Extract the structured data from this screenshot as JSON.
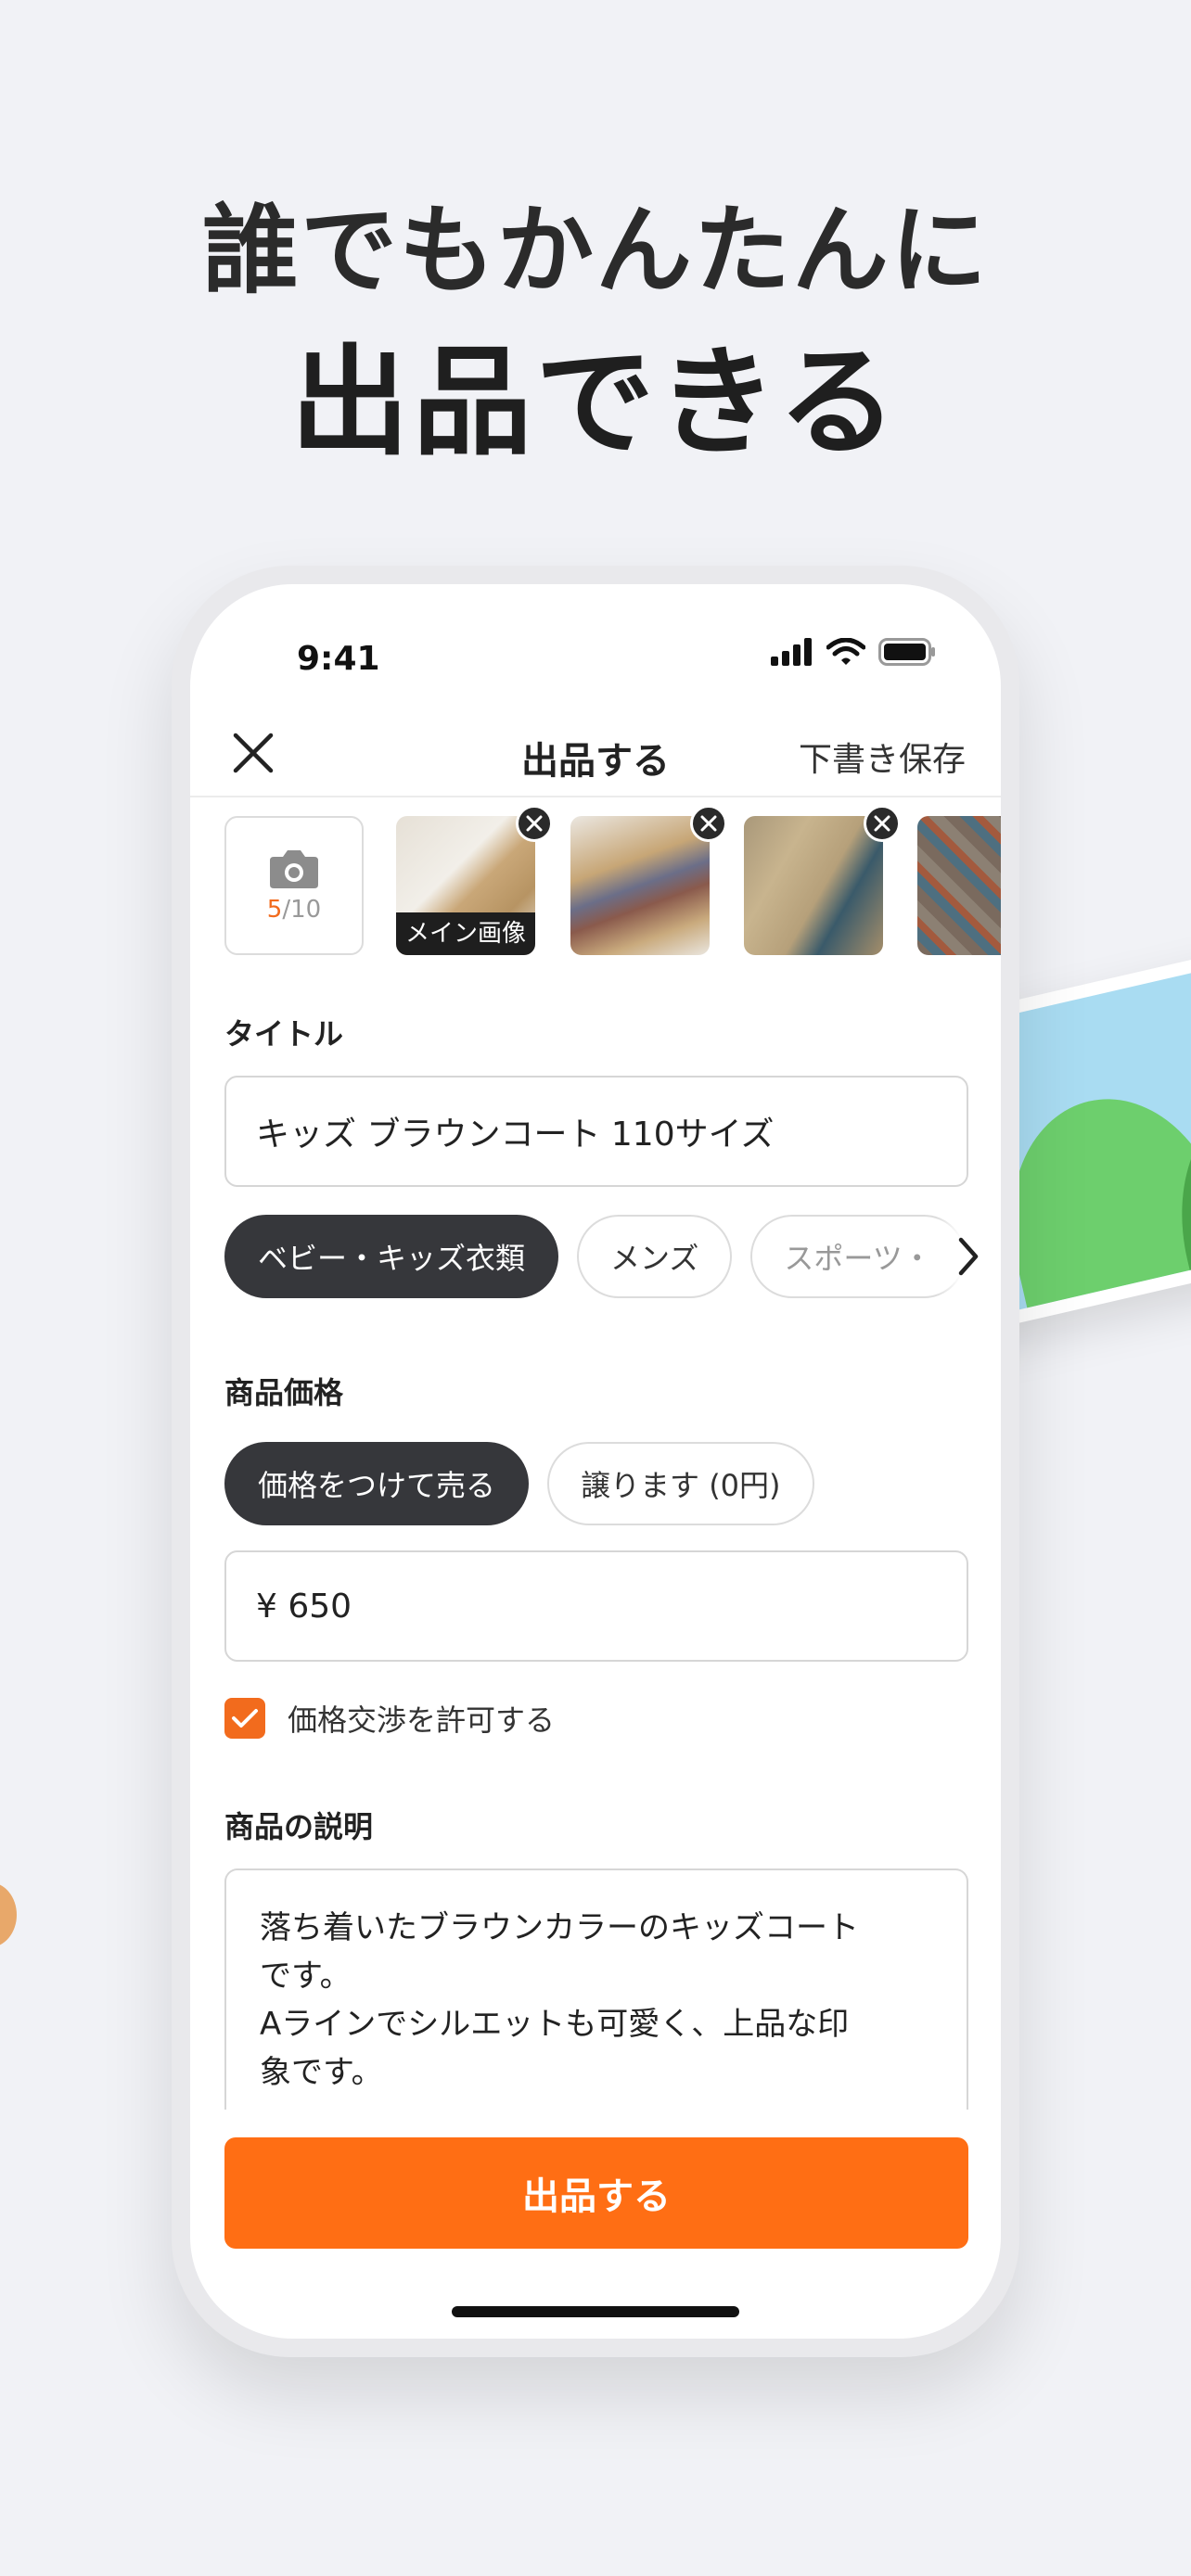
{
  "hero": {
    "line1": "誰でもかんたんに",
    "line2": "出品できる"
  },
  "status_bar": {
    "time": "9:41"
  },
  "nav": {
    "title": "出品する",
    "draft_label": "下書き保存"
  },
  "photos": {
    "count_current": "5",
    "count_total": "/10",
    "main_label": "メイン画像"
  },
  "title_section": {
    "label": "タイトル",
    "value": "キッズ ブラウンコート 110サイズ"
  },
  "categories": [
    {
      "label": "ベビー・キッズ衣類"
    },
    {
      "label": "メンズ"
    },
    {
      "label": "スポーツ・"
    }
  ],
  "price_section": {
    "label": "商品価格",
    "options": [
      {
        "label": "価格をつけて売る"
      },
      {
        "label": "譲ります (0円)"
      }
    ],
    "value": "¥ 650",
    "negotiation_label": "価格交渉を許可する"
  },
  "description_section": {
    "label": "商品の説明",
    "line1": "落ち着いたブラウンカラーのキッズコート",
    "line2": "です。",
    "line3": "Aラインでシルエットも可愛く、上品な印",
    "line4": "象です。"
  },
  "submit": {
    "label": "出品する"
  },
  "colors": {
    "accent": "#ff6e14",
    "chip_active": "#36373b",
    "background": "#f1f2f6"
  }
}
